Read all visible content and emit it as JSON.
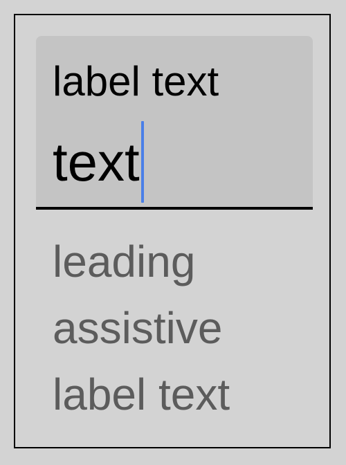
{
  "text_field": {
    "label": "label text",
    "value": "text",
    "assistive_text": "leading\nassistive\nlabel text"
  },
  "colors": {
    "background": "#d3d3d3",
    "field_fill": "#c4c4c4",
    "caret": "#4a7fe8",
    "assistive_text": "#5c5c5c",
    "indicator": "#000000"
  }
}
